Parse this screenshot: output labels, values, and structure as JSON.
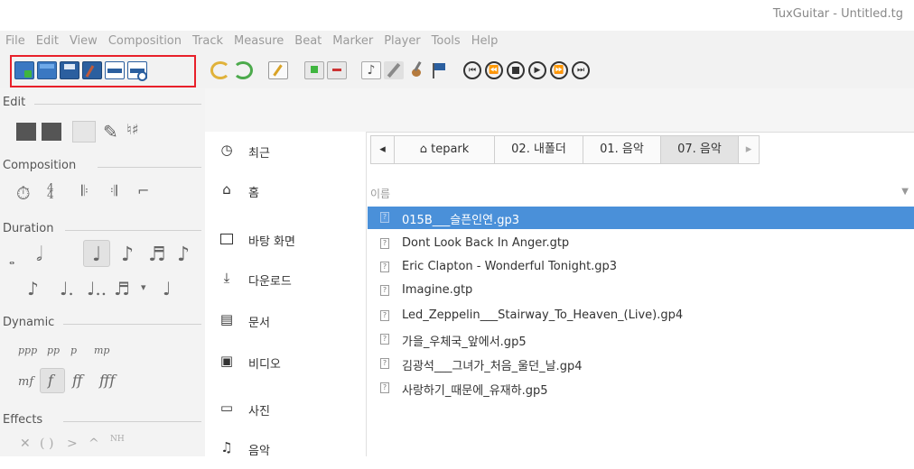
{
  "window": {
    "title": "TuxGuitar - Untitled.tg"
  },
  "menu": [
    "File",
    "Edit",
    "View",
    "Composition",
    "Track",
    "Measure",
    "Beat",
    "Marker",
    "Player",
    "Tools",
    "Help"
  ],
  "left_panel": {
    "sections": [
      "Edit",
      "Composition",
      "Duration",
      "Dynamic",
      "Effects"
    ],
    "dynamics_row1": [
      "ppp",
      "pp",
      "p",
      "mp"
    ],
    "dynamics_row2": [
      "mf",
      "f",
      "ff",
      "fff"
    ],
    "effects_row": [
      "(",
      ")",
      "NH"
    ]
  },
  "places": [
    {
      "icon": "recent-icon",
      "label": "최근"
    },
    {
      "icon": "home-icon",
      "label": "홈"
    },
    {
      "icon": "desktop-icon",
      "label": "바탕 화면"
    },
    {
      "icon": "download-icon",
      "label": "다운로드"
    },
    {
      "icon": "document-icon",
      "label": "문서"
    },
    {
      "icon": "video-icon",
      "label": "비디오"
    },
    {
      "icon": "picture-icon",
      "label": "사진"
    },
    {
      "icon": "music-icon",
      "label": "음악"
    }
  ],
  "breadcrumbs": [
    "tepark",
    "02. 내폴더",
    "01. 음악",
    "07. 음악"
  ],
  "file_list": {
    "column_name": "이름",
    "selected_index": 0,
    "files": [
      "015B___슬픈인연.gp3",
      "Dont Look Back In Anger.gtp",
      "Eric Clapton - Wonderful Tonight.gp3",
      "Imagine.gtp",
      "Led_Zeppelin___Stairway_To_Heaven_(Live).gp4",
      "가을_우체국_앞에서.gp5",
      "김광석___그녀가_처음_울던_날.gp4",
      "사랑하기_때문에_유재하.gp5"
    ]
  },
  "colors": {
    "highlight": "#e8202a",
    "selection": "#4a90d9"
  }
}
